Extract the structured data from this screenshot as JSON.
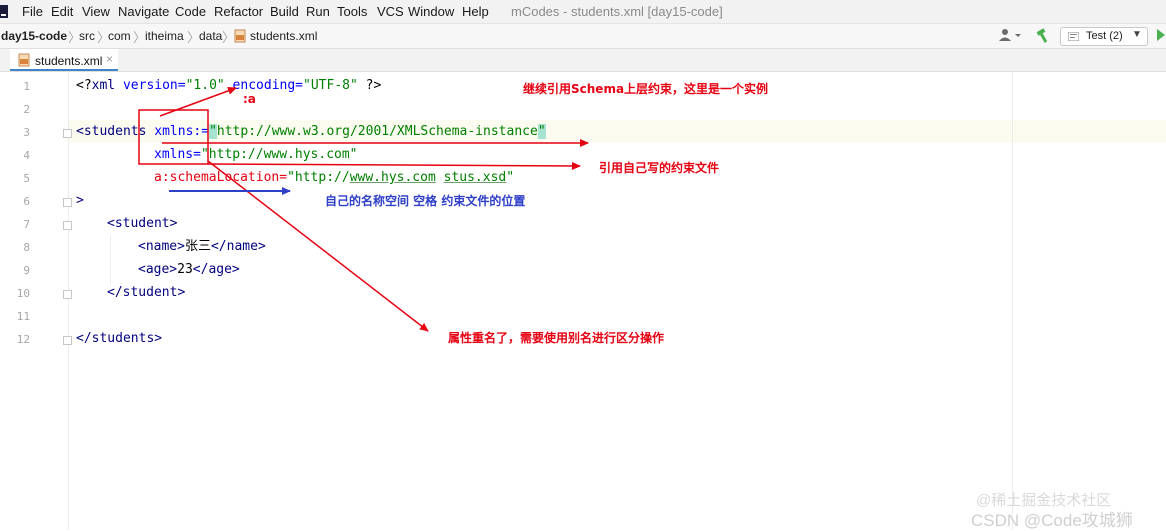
{
  "menubar": {
    "items": [
      "File",
      "Edit",
      "View",
      "Navigate",
      "Code",
      "Refactor",
      "Build",
      "Run",
      "Tools",
      "VCS",
      "Window",
      "Help"
    ],
    "window_title": "mCodes - students.xml [day15-code]"
  },
  "breadcrumb": [
    "day15-code",
    "src",
    "com",
    "itheima",
    "data",
    "students.xml"
  ],
  "toolbar": {
    "run_config_label": "Test (2)",
    "icons": [
      "user-icon",
      "build-hammer-icon",
      "run-icon"
    ]
  },
  "tabs": [
    {
      "label": "students.xml",
      "close": "×"
    }
  ],
  "editor": {
    "line_numbers": [
      "1",
      "2",
      "3",
      "4",
      "5",
      "6",
      "7",
      "8",
      "9",
      "10",
      "11",
      "12"
    ],
    "lines": [
      "<?xml version=\"1.0\" encoding=\"UTF-8\" ?>",
      "",
      "<students xmlns:=\"http://www.w3.org/2001/XMLSchema-instance\"",
      "          xmlns=\"http://www.hys.com\"",
      "          a:schemaLocation=\"http://www.hys.com stus.xsd\"",
      ">",
      "    <student>",
      "        <name>张三</name>",
      "        <age>23</age>",
      "    </student>",
      "",
      "</students>"
    ],
    "tokens": {
      "l1_pi_open": "<?",
      "l1_xml": "xml",
      "l1_version_attr": " version=",
      "l1_version_val": "\"1.0\"",
      "l1_encoding_attr": " encoding=",
      "l1_encoding_val": "\"UTF-8\"",
      "l1_pi_close": " ?>",
      "l3_tag": "<students",
      "l3_attr": " xmlns:",
      "l3_eq": "=",
      "l3_q1": "\"",
      "l3_val": "http://www.w3.org/2001/XMLSchema-instance",
      "l3_q2": "\"",
      "l4_attr": "xmlns=",
      "l4_val": "\"http://www.hys.com\"",
      "l5_attr": "a:schemaLocation=",
      "l5_val_a": "\"http://",
      "l5_val_b": "www.hys.com",
      "l5_val_c": " ",
      "l5_val_d": "stus.xsd",
      "l5_val_e": "\"",
      "l6": ">",
      "l7_tag": "<student>",
      "l8_open": "<name>",
      "l8_text": "张三",
      "l8_close": "</name>",
      "l9_open": "<age>",
      "l9_text": "23",
      "l9_close": "</age>",
      "l10_tag": "</student>",
      "l12_tag": "</students>"
    }
  },
  "annotations": {
    "label_a": ":a",
    "note_1": "继续引用Schema上层约束，这里是一个实例",
    "note_2": "引用自己写的约束文件",
    "note_3": "自己的名称空间  空格  约束文件的位置",
    "note_4": "属性重名了，需要使用别名进行区分操作"
  },
  "colors": {
    "annotation_red": "#e60012",
    "annotation_blue": "#2e3fc8",
    "xml_tag": "#000080",
    "xml_attr": "#0000ff",
    "xml_string": "#008000"
  },
  "watermark": {
    "line1": "@稀土掘金技术社区",
    "line2": "CSDN @Code攻城狮"
  }
}
